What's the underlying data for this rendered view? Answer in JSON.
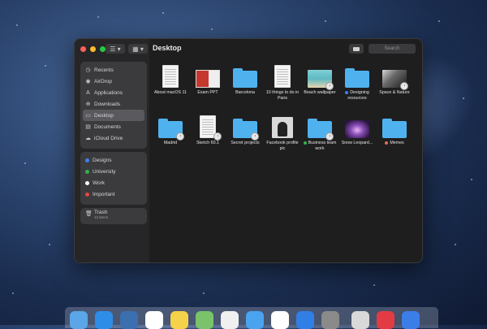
{
  "window": {
    "title": "Desktop",
    "view_list_label": "☰ ▾",
    "view_grid_label": "▦ ▾",
    "search_placeholder": "Search"
  },
  "sidebar": {
    "favorites": [
      {
        "label": "Recents",
        "icon": "clock-icon"
      },
      {
        "label": "AirDrop",
        "icon": "airdrop-icon"
      },
      {
        "label": "Applications",
        "icon": "applications-icon"
      },
      {
        "label": "Downloads",
        "icon": "download-icon"
      },
      {
        "label": "Desktop",
        "icon": "desktop-icon",
        "active": true
      },
      {
        "label": "Documents",
        "icon": "documents-icon"
      },
      {
        "label": "iCloud Drive",
        "icon": "cloud-icon"
      }
    ],
    "tags": [
      {
        "label": "Designs",
        "color": "#3f7ff2"
      },
      {
        "label": "University",
        "color": "#33b44a"
      },
      {
        "label": "Work",
        "color": "#ffffff"
      },
      {
        "label": "Important",
        "color": "#e0483e"
      }
    ],
    "trash": {
      "label": "Trash",
      "count": "12 items"
    }
  },
  "files": [
    {
      "label": "About macOS 11",
      "kind": "doc"
    },
    {
      "label": "Exam PPT",
      "kind": "slide"
    },
    {
      "label": "Barcelona",
      "kind": "folder"
    },
    {
      "label": "10 things to do in Paris",
      "kind": "doc"
    },
    {
      "label": "Beach wallpaper",
      "kind": "photo-beach",
      "badge": true
    },
    {
      "label": "Designing resources",
      "kind": "folder",
      "tag": "#3f7ff2"
    },
    {
      "label": "Space & Nature",
      "kind": "photo-space",
      "badge": true
    },
    {
      "label": "Madrid",
      "kind": "folder",
      "badge": true
    },
    {
      "label": "Sketch 60.1",
      "kind": "doc",
      "badge": true
    },
    {
      "label": "Secret projects",
      "kind": "folder",
      "badge": true
    },
    {
      "label": "Facebook profile pic",
      "kind": "photo-portrait"
    },
    {
      "label": "Business team work",
      "kind": "folder",
      "badge": true,
      "tag": "#33b44a"
    },
    {
      "label": "Snow Leopard...",
      "kind": "photo-leopard"
    },
    {
      "label": "Memes",
      "kind": "folder",
      "tag": "#e0704a"
    }
  ],
  "colors": {
    "close": "#ff5f57",
    "minimize": "#febc2e",
    "zoom": "#28c840",
    "folder": "#4fb2ef"
  }
}
